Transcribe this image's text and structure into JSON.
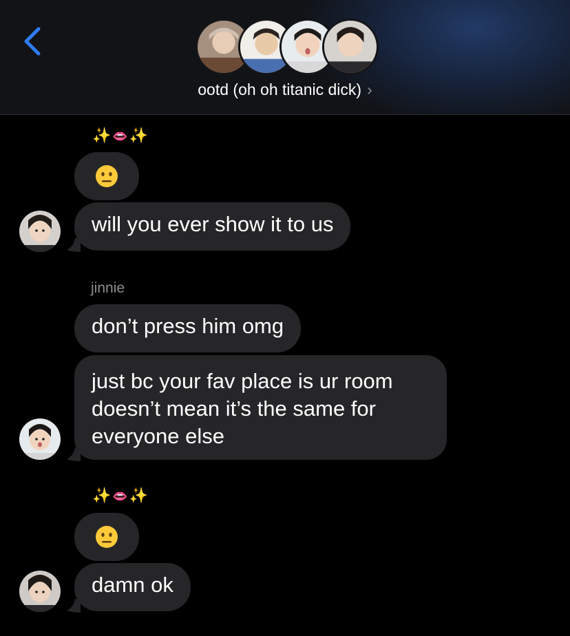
{
  "header": {
    "back_label": "‹",
    "group_name": "ootd (oh oh titanic dick)",
    "chevron": "›",
    "avatars": [
      "member-1",
      "member-2",
      "member-3",
      "member-4"
    ]
  },
  "messages": [
    {
      "reaction": [
        "✨",
        "👄",
        "✨"
      ]
    },
    {
      "emoji_icon": "neutral-face-emoji"
    },
    {
      "text": "will you ever show it to us"
    },
    {
      "sender": "jinnie"
    },
    {
      "text": "don’t press him omg"
    },
    {
      "lines": [
        "just bc your fav place is ur room",
        "doesn’t mean it’s the same for",
        "everyone else"
      ]
    },
    {
      "reaction": [
        "✨",
        "👄",
        "✨"
      ]
    },
    {
      "emoji_icon": "neutral-face-emoji"
    },
    {
      "text": "damn ok"
    }
  ],
  "colors": {
    "accent": "#2f7cf6",
    "bubble": "#262629",
    "background": "#000000",
    "secondary_text": "#8e8e93"
  }
}
